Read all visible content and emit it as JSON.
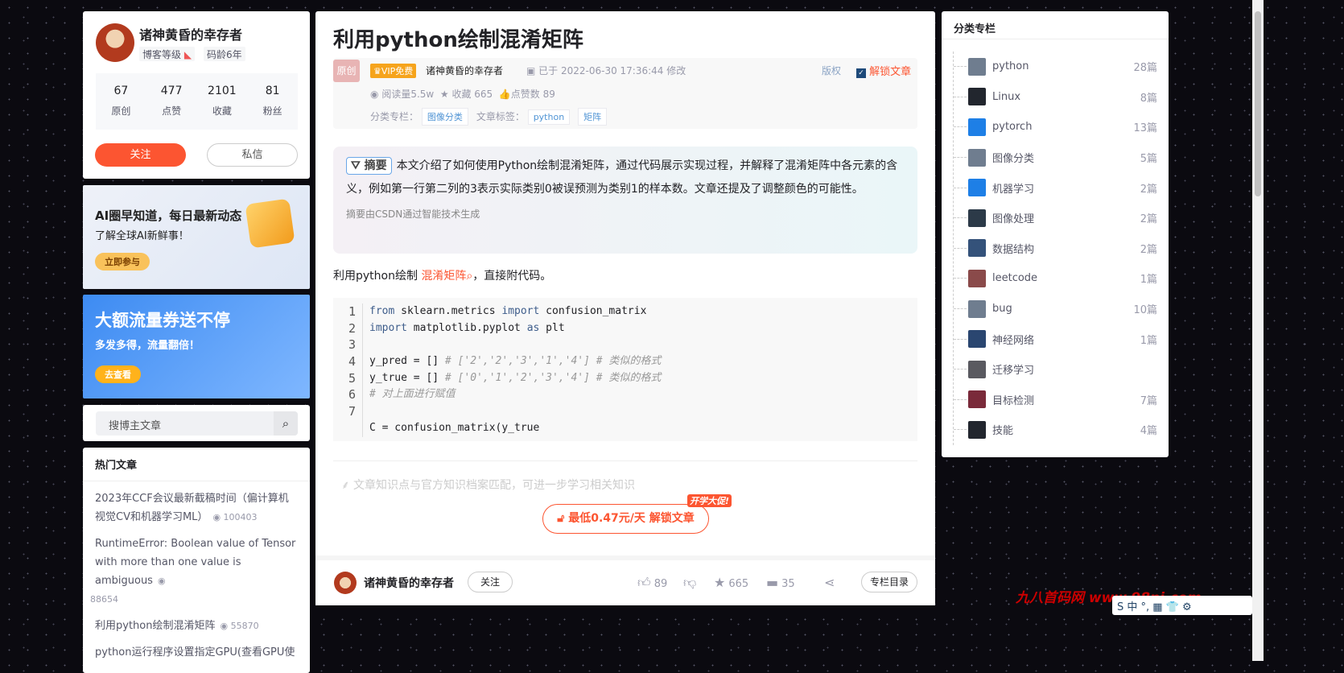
{
  "profile": {
    "name": "诸神黄昏的幸存者",
    "level_label": "博客等级",
    "code_age": "码龄6年",
    "stats": [
      {
        "value": "67",
        "label": "原创"
      },
      {
        "value": "477",
        "label": "点赞"
      },
      {
        "value": "2101",
        "label": "收藏"
      },
      {
        "value": "81",
        "label": "粉丝"
      }
    ],
    "follow": "关注",
    "message": "私信"
  },
  "banners": [
    {
      "title": "AI圈早知道，每日最新动态",
      "subtitle": "了解全球AI新鲜事！",
      "button": "立即参与"
    },
    {
      "title": "大额流量券送不停",
      "subtitle": "多发多得，流量翻倍！",
      "button": "去查看"
    }
  ],
  "search": {
    "placeholder": "搜博主文章"
  },
  "hot": {
    "title": "热门文章",
    "items": [
      {
        "title": "2023年CCF会议最新截稿时间（偏计算机视觉CV和机器学习ML）",
        "views": "100403"
      },
      {
        "title": "RuntimeError: Boolean value of Tensor with more than one value is ambiguous",
        "views": "88654"
      },
      {
        "title": "利用python绘制混淆矩阵",
        "views": "55870"
      },
      {
        "title": "python运行程序设置指定GPU(查看GPU使",
        "views": ""
      }
    ]
  },
  "article": {
    "title": "利用python绘制混淆矩阵",
    "original": "原创",
    "vip": "VIP免费",
    "author": "诸神黄昏的幸存者",
    "modified": "已于 2022-06-30 17:36:44 修改",
    "copyright": "版权",
    "unlock_link": "解锁文章",
    "reads": "阅读量5.5w",
    "favorites": "收藏 665",
    "likes": "点赞数 89",
    "category_label": "分类专栏：",
    "category": "图像分类",
    "tags_label": "文章标签：",
    "tags": [
      "python",
      "矩阵"
    ],
    "summary_tag": "摘要",
    "summary": "本文介绍了如何使用Python绘制混淆矩阵，通过代码展示实现过程，并解释了混淆矩阵中各元素的含义，例如第一行第二列的3表示实际类别0被误预测为类别1的样本数。文章还提及了调整颜色的可能性。",
    "summary_note": "摘要由CSDN通过智能技术生成",
    "intro_before": "利用python绘制",
    "intro_link": "混淆矩阵",
    "intro_after": "，直接附代码。",
    "code": [
      {
        "n": "1",
        "a": "from",
        "b": " sklearn.metrics ",
        "c": "import",
        "d": " confusion_matrix",
        "e": ""
      },
      {
        "n": "2",
        "a": "import",
        "b": " matplotlib.pyplot ",
        "c": "as",
        "d": " plt",
        "e": ""
      },
      {
        "n": "3",
        "a": "",
        "b": "",
        "c": "",
        "d": "",
        "e": ""
      },
      {
        "n": "4",
        "a": "",
        "b": "y_pred = [] ",
        "c": "",
        "d": "",
        "e": "# ['2','2','3','1','4'] # 类似的格式"
      },
      {
        "n": "5",
        "a": "",
        "b": "y_true = [] ",
        "c": "",
        "d": "",
        "e": "# ['0','1','2','3','4'] # 类似的格式"
      },
      {
        "n": "6",
        "a": "",
        "b": "",
        "c": "",
        "d": "",
        "e": "# 对上面进行赋值"
      },
      {
        "n": "7",
        "a": "",
        "b": "",
        "c": "",
        "d": "",
        "e": ""
      },
      {
        "n": "",
        "a": "",
        "b": "C = confusion_matrix(y_true",
        "c": "",
        "d": "",
        "e": ""
      }
    ],
    "knowledge": "文章知识点与官方知识档案匹配，可进一步学习相关知识",
    "unlock_button": "最低0.47元/天 解锁文章",
    "promo": "开学大促!"
  },
  "toolbar": {
    "author": "诸神黄昏的幸存者",
    "follow": "关注",
    "likes": "89",
    "favorites": "665",
    "comments": "35",
    "directory": "专栏目录"
  },
  "categories": {
    "title": "分类专栏",
    "items": [
      {
        "name": "python",
        "count": "28篇",
        "color": "#6f7d8f"
      },
      {
        "name": "Linux",
        "count": "8篇",
        "color": "#22262e"
      },
      {
        "name": "pytorch",
        "count": "13篇",
        "color": "#1e7fe6"
      },
      {
        "name": "图像分类",
        "count": "5篇",
        "color": "#6f7d8f"
      },
      {
        "name": "机器学习",
        "count": "2篇",
        "color": "#1e7fe6"
      },
      {
        "name": "图像处理",
        "count": "2篇",
        "color": "#2c3a48"
      },
      {
        "name": "数据结构",
        "count": "2篇",
        "color": "#34527a"
      },
      {
        "name": "leetcode",
        "count": "1篇",
        "color": "#8a4a4a"
      },
      {
        "name": "bug",
        "count": "10篇",
        "color": "#6f7d8f"
      },
      {
        "name": "神经网络",
        "count": "1篇",
        "color": "#2a4670"
      },
      {
        "name": "迁移学习",
        "count": "",
        "color": "#5a5a60"
      },
      {
        "name": "目标检测",
        "count": "7篇",
        "color": "#7a2a3a"
      },
      {
        "name": "技能",
        "count": "4篇",
        "color": "#22262e"
      }
    ]
  },
  "watermark": "九八首码网 www.98ni.com",
  "ime": "S 中 °, ▦ 👕 ⚙"
}
